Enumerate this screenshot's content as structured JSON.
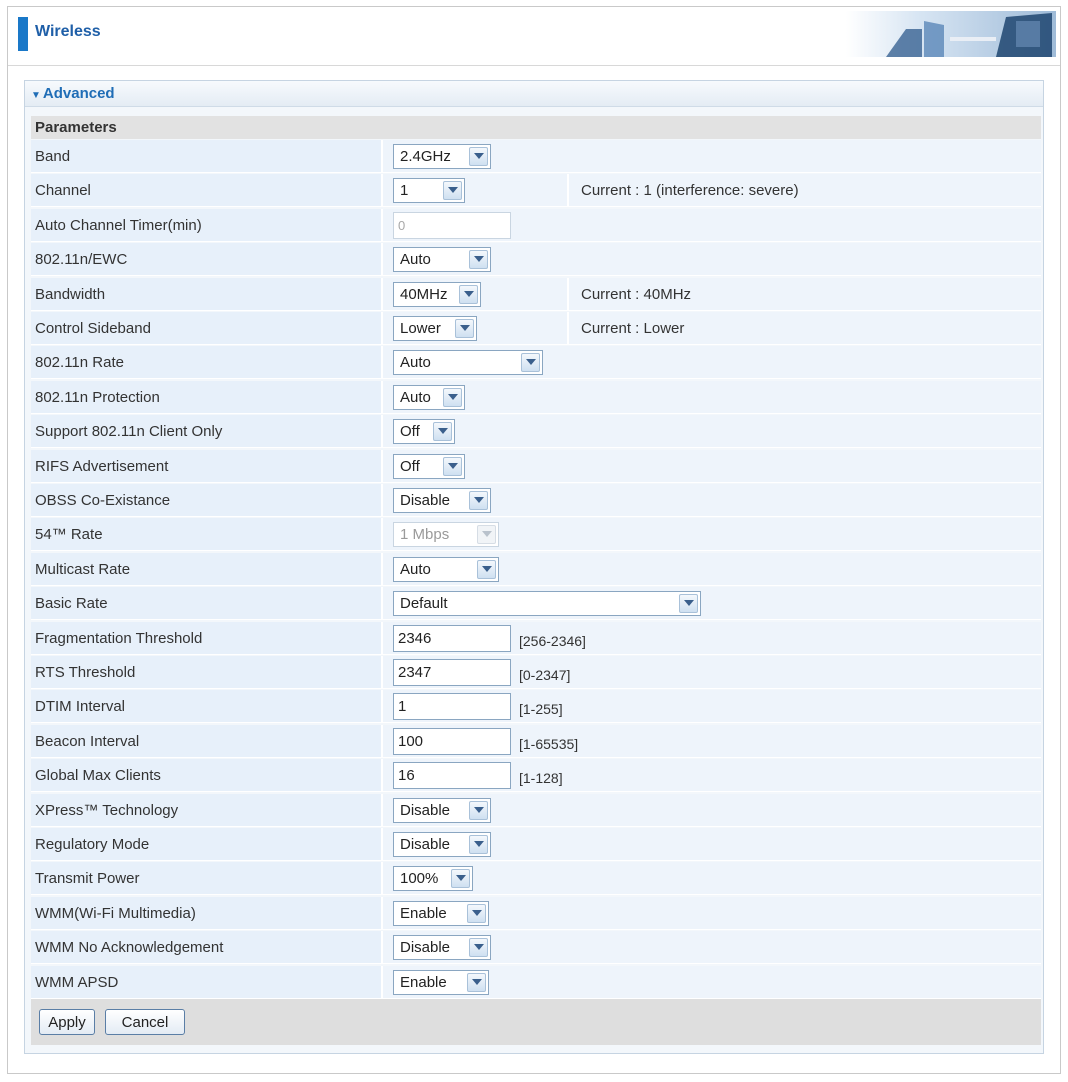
{
  "header": {
    "title": "Wireless"
  },
  "section": {
    "title": "Advanced"
  },
  "params_header": "Parameters",
  "rows": [
    {
      "label": "Band",
      "type": "select",
      "value": "2.4GHz",
      "w": 98
    },
    {
      "label": "Channel",
      "type": "select",
      "value": "1",
      "w": 72,
      "current": "Current : 1 (interference: severe)"
    },
    {
      "label": "Auto Channel Timer(min)",
      "type": "input",
      "value": "0",
      "disabled": true
    },
    {
      "label": "802.11n/EWC",
      "type": "select",
      "value": "Auto",
      "w": 98
    },
    {
      "label": "Bandwidth",
      "type": "select",
      "value": "40MHz",
      "w": 88,
      "current": "Current : 40MHz"
    },
    {
      "label": "Control Sideband",
      "type": "select",
      "value": "Lower",
      "w": 84,
      "current": "Current : Lower"
    },
    {
      "label": "802.11n Rate",
      "type": "select",
      "value": "Auto",
      "w": 150
    },
    {
      "label": "802.11n Protection",
      "type": "select",
      "value": "Auto",
      "w": 72
    },
    {
      "label": "Support 802.11n Client Only",
      "type": "select",
      "value": "Off",
      "w": 62
    },
    {
      "label": "RIFS Advertisement",
      "type": "select",
      "value": "Off",
      "w": 72
    },
    {
      "label": "OBSS Co-Existance",
      "type": "select",
      "value": "Disable",
      "w": 98
    },
    {
      "label": "54™ Rate",
      "type": "select",
      "value": "1 Mbps",
      "w": 106,
      "disabled": true
    },
    {
      "label": "Multicast Rate",
      "type": "select",
      "value": "Auto",
      "w": 106
    },
    {
      "label": "Basic Rate",
      "type": "select",
      "value": "Default",
      "w": 308
    },
    {
      "label": "Fragmentation Threshold",
      "type": "input",
      "value": "2346",
      "range": "[256-2346]"
    },
    {
      "label": "RTS Threshold",
      "type": "input",
      "value": "2347",
      "range": "[0-2347]"
    },
    {
      "label": "DTIM Interval",
      "type": "input",
      "value": "1",
      "range": "[1-255]"
    },
    {
      "label": "Beacon Interval",
      "type": "input",
      "value": "100",
      "range": "[1-65535]"
    },
    {
      "label": "Global Max Clients",
      "type": "input",
      "value": "16",
      "range": "[1-128]"
    },
    {
      "label": "XPress™ Technology",
      "type": "select",
      "value": "Disable",
      "w": 98
    },
    {
      "label": "Regulatory Mode",
      "type": "select",
      "value": "Disable",
      "w": 98
    },
    {
      "label": "Transmit Power",
      "type": "select",
      "value": "100%",
      "w": 80
    },
    {
      "label": "WMM(Wi-Fi Multimedia)",
      "type": "select",
      "value": "Enable",
      "w": 96
    },
    {
      "label": "WMM No Acknowledgement",
      "type": "select",
      "value": "Disable",
      "w": 98
    },
    {
      "label": "WMM APSD",
      "type": "select",
      "value": "Enable",
      "w": 96
    }
  ],
  "buttons": {
    "apply": "Apply",
    "cancel": "Cancel"
  },
  "colors": {
    "accent": "#1a78c8",
    "title": "#1f6db6",
    "row_bg": "#e7f0fa"
  }
}
